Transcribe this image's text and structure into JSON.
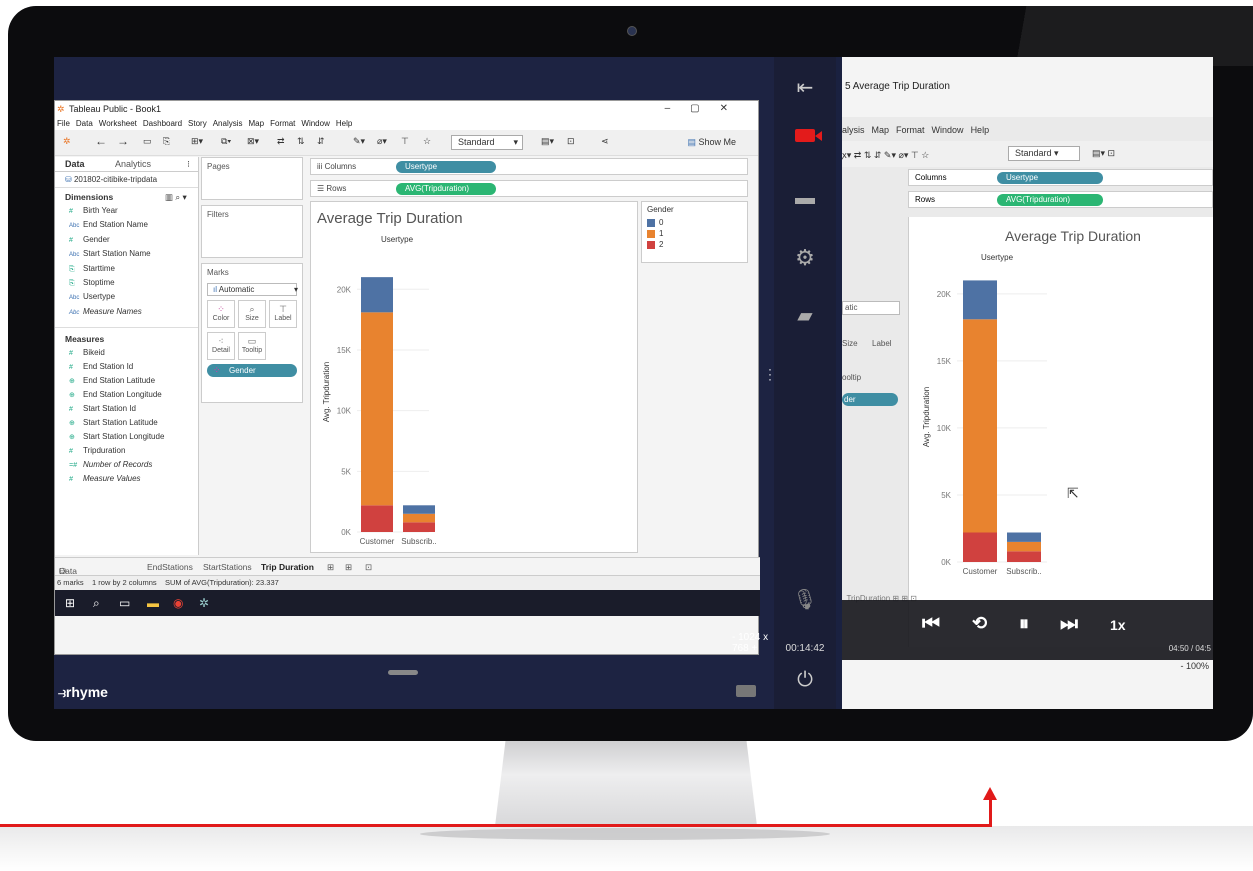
{
  "tableau": {
    "window_title": "Tableau Public - Book1",
    "menu": [
      "File",
      "Data",
      "Worksheet",
      "Dashboard",
      "Story",
      "Analysis",
      "Map",
      "Format",
      "Window",
      "Help"
    ],
    "standard_label": "Standard",
    "show_me_label": "Show Me",
    "data_tab": "Data",
    "analytics_tab": "Analytics",
    "data_source": "201802-citibike-tripdata",
    "dimensions_header": "Dimensions",
    "dimensions": [
      "Birth Year",
      "End Station Name",
      "Gender",
      "Start Station Name",
      "Starttime",
      "Stoptime",
      "Usertype",
      "Measure Names"
    ],
    "measures_header": "Measures",
    "measures": [
      "Bikeid",
      "End Station Id",
      "End Station Latitude",
      "End Station Longitude",
      "Start Station Id",
      "Start Station Latitude",
      "Start Station Longitude",
      "Tripduration",
      "Number of Records",
      "Measure Values"
    ],
    "pages_label": "Pages",
    "filters_label": "Filters",
    "marks_label": "Marks",
    "mark_type": "Automatic",
    "mark_color": "Color",
    "mark_size": "Size",
    "mark_label": "Label",
    "mark_detail": "Detail",
    "mark_tooltip": "Tooltip",
    "gender_pill": "Gender",
    "columns_label": "Columns",
    "rows_label": "Rows",
    "columns_pill": "Usertype",
    "rows_pill": "AVG(Tripduration)",
    "legend_title": "Gender",
    "legend_items": [
      "0",
      "1",
      "2"
    ],
    "sheet_tabs": [
      "Data Source",
      "EndStations",
      "StartStations",
      "Trip Duration"
    ],
    "status_marks": "6 marks",
    "status_dims": "1 row by 2 columns",
    "status_sum": "SUM of AVG(Tripduration): 23.337"
  },
  "chart_data": {
    "type": "bar",
    "title": "Average Trip Duration",
    "subtitle": "Usertype",
    "ylabel": "Avg. Tripduration",
    "categories": [
      "Customer",
      "Subscrib.."
    ],
    "ytick_labels": [
      "0K",
      "5K",
      "10K",
      "15K",
      "20K"
    ],
    "ylim": [
      0,
      22000
    ],
    "stacked": true,
    "series": [
      {
        "name": "2",
        "color": "#d0413f",
        "values": [
          2200,
          800
        ]
      },
      {
        "name": "1",
        "color": "#e8832f",
        "values": [
          15900,
          700
        ]
      },
      {
        "name": "0",
        "color": "#4e72a4",
        "values": [
          2900,
          700
        ]
      }
    ]
  },
  "screen": {
    "resolution_label": "- 1024 x 768 +",
    "logo": "rhyme",
    "timer": "00:14:42"
  },
  "video": {
    "title": "5  Average Trip Duration",
    "menu": [
      "alysis",
      "Map",
      "Format",
      "Window",
      "Help"
    ],
    "standard_label": "Standard",
    "columns_label": "Columns",
    "rows_label": "Rows",
    "columns_pill": "Usertype",
    "rows_pill": "AVG(Tripduration)",
    "chart_title": "Average Trip Duration",
    "chart_subtitle": "Usertype",
    "ylabel": "Avg. Tripduration",
    "ytick_labels": [
      "0K",
      "5K",
      "10K",
      "15K",
      "20K"
    ],
    "categories": [
      "Customer",
      "Subscrib.."
    ],
    "marks_fragments": [
      "atic",
      "Size",
      "Label",
      "ooltip",
      "der"
    ],
    "sheet_tab": "TripDuration",
    "speed": "1x",
    "time": "04:50 / 04:5",
    "zoom": "- 100%"
  }
}
